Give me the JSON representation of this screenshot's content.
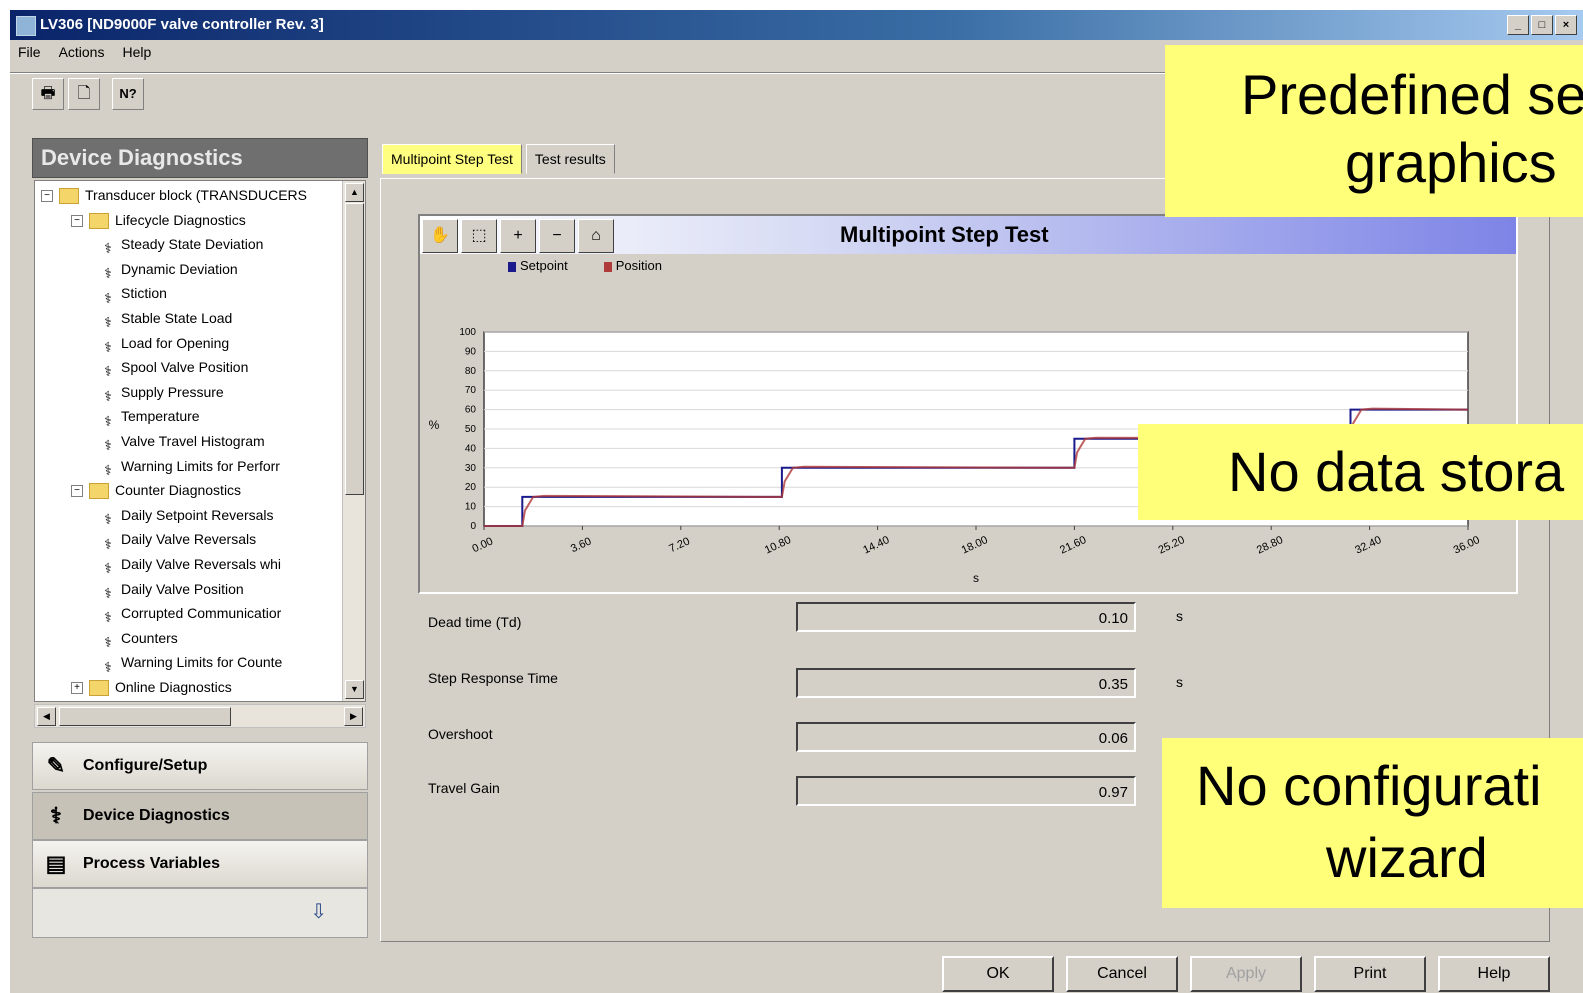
{
  "window": {
    "title": "LV306 [ND9000F valve controller Rev. 3]",
    "controls": [
      "_",
      "□",
      "×"
    ]
  },
  "menu": [
    "File",
    "Actions",
    "Help"
  ],
  "toolbar": {
    "icons": [
      "print-icon",
      "print-preview-icon",
      "context-help-icon"
    ],
    "glyphs": [
      "🖶",
      "🗋",
      "N?"
    ]
  },
  "left_panel": {
    "header": "Device Diagnostics",
    "tree": [
      {
        "label": "Transducer block (TRANSDUCERS",
        "kind": "folder",
        "exp": "−"
      },
      {
        "label": "Lifecycle Diagnostics",
        "kind": "folder",
        "exp": "−"
      },
      {
        "label": "Steady State Deviation",
        "kind": "diag"
      },
      {
        "label": "Dynamic Deviation",
        "kind": "diag"
      },
      {
        "label": "Stiction",
        "kind": "diag"
      },
      {
        "label": "Stable State Load",
        "kind": "diag"
      },
      {
        "label": "Load for Opening",
        "kind": "diag"
      },
      {
        "label": "Spool Valve Position",
        "kind": "diag"
      },
      {
        "label": "Supply Pressure",
        "kind": "diag"
      },
      {
        "label": "Temperature",
        "kind": "diag"
      },
      {
        "label": "Valve Travel Histogram",
        "kind": "diag"
      },
      {
        "label": "Warning Limits for Perforr",
        "kind": "diag"
      },
      {
        "label": "Counter Diagnostics",
        "kind": "folder",
        "exp": "−"
      },
      {
        "label": "Daily Setpoint Reversals",
        "kind": "diag"
      },
      {
        "label": "Daily Valve Reversals",
        "kind": "diag"
      },
      {
        "label": "Daily Valve Reversals whi",
        "kind": "diag"
      },
      {
        "label": "Daily Valve Position",
        "kind": "diag"
      },
      {
        "label": "Corrupted Communicatior",
        "kind": "diag"
      },
      {
        "label": "Counters",
        "kind": "diag"
      },
      {
        "label": "Warning Limits for Counte",
        "kind": "diag"
      },
      {
        "label": "Online Diagnostics",
        "kind": "folder",
        "exp": "+"
      }
    ],
    "nav": [
      {
        "label": "Configure/Setup",
        "icon": "configure-icon",
        "glyph": "✎"
      },
      {
        "label": "Device Diagnostics",
        "icon": "diagnostics-icon",
        "glyph": "⚕"
      },
      {
        "label": "Process Variables",
        "icon": "process-variables-icon",
        "glyph": "▤"
      }
    ],
    "footer_icon": "collapse-panel-icon"
  },
  "tabs": [
    "Multipoint Step Test",
    "Test results"
  ],
  "chart": {
    "title": "Multipoint Step Test",
    "tools": [
      "pan-icon",
      "zoom-box-icon",
      "zoom-in-icon",
      "zoom-out-icon",
      "home-icon"
    ],
    "tool_glyphs": [
      "✋",
      "⬚",
      "+",
      "−",
      "⌂"
    ]
  },
  "chart_data": {
    "type": "line",
    "title": "Multipoint Step Test",
    "xlabel": "s",
    "ylabel": "%",
    "xlim": [
      0,
      36
    ],
    "ylim": [
      0,
      100
    ],
    "xticks": [
      "0.00",
      "3.60",
      "7.20",
      "10.80",
      "14.40",
      "18.00",
      "21.60",
      "25.20",
      "28.80",
      "32.40",
      "36.00"
    ],
    "yticks": [
      "0",
      "10",
      "20",
      "30",
      "40",
      "50",
      "60",
      "70",
      "80",
      "90",
      "100"
    ],
    "grid": true,
    "legend": "top-left",
    "series": [
      {
        "name": "Setpoint",
        "color": "#1a1a8c",
        "x": [
          0,
          1.4,
          1.4,
          10.9,
          10.9,
          21.6,
          21.6,
          31.7,
          31.7,
          36
        ],
        "y": [
          0,
          0,
          15,
          15,
          30,
          30,
          45,
          45,
          60,
          60
        ]
      },
      {
        "name": "Position",
        "color": "#b03a3a",
        "x": [
          0,
          1.4,
          1.5,
          1.8,
          2.2,
          10.9,
          11.0,
          11.3,
          11.7,
          21.6,
          21.7,
          22.0,
          22.4,
          31.7,
          31.8,
          32.1,
          32.5,
          36
        ],
        "y": [
          0,
          0,
          8,
          15,
          15.5,
          15,
          23,
          30,
          30.5,
          30,
          38,
          45,
          45.5,
          45,
          53,
          60,
          60.5,
          60
        ]
      }
    ]
  },
  "results": [
    {
      "label": "Dead time (Td)",
      "value": "0.10",
      "unit": "s"
    },
    {
      "label": "Step Response Time",
      "value": "0.35",
      "unit": "s"
    },
    {
      "label": "Overshoot",
      "value": "0.06",
      "unit": ""
    },
    {
      "label": "Travel Gain",
      "value": "0.97",
      "unit": ""
    }
  ],
  "callouts": [
    {
      "lines": [
        "Predefined se",
        "graphics"
      ]
    },
    {
      "lines": [
        "No data stora"
      ]
    },
    {
      "lines": [
        "No configurati",
        "wizard"
      ]
    }
  ],
  "buttons": [
    {
      "label": "OK",
      "enabled": true
    },
    {
      "label": "Cancel",
      "enabled": true
    },
    {
      "label": "Apply",
      "enabled": false
    },
    {
      "label": "Print",
      "enabled": true
    },
    {
      "label": "Help",
      "enabled": true
    }
  ]
}
